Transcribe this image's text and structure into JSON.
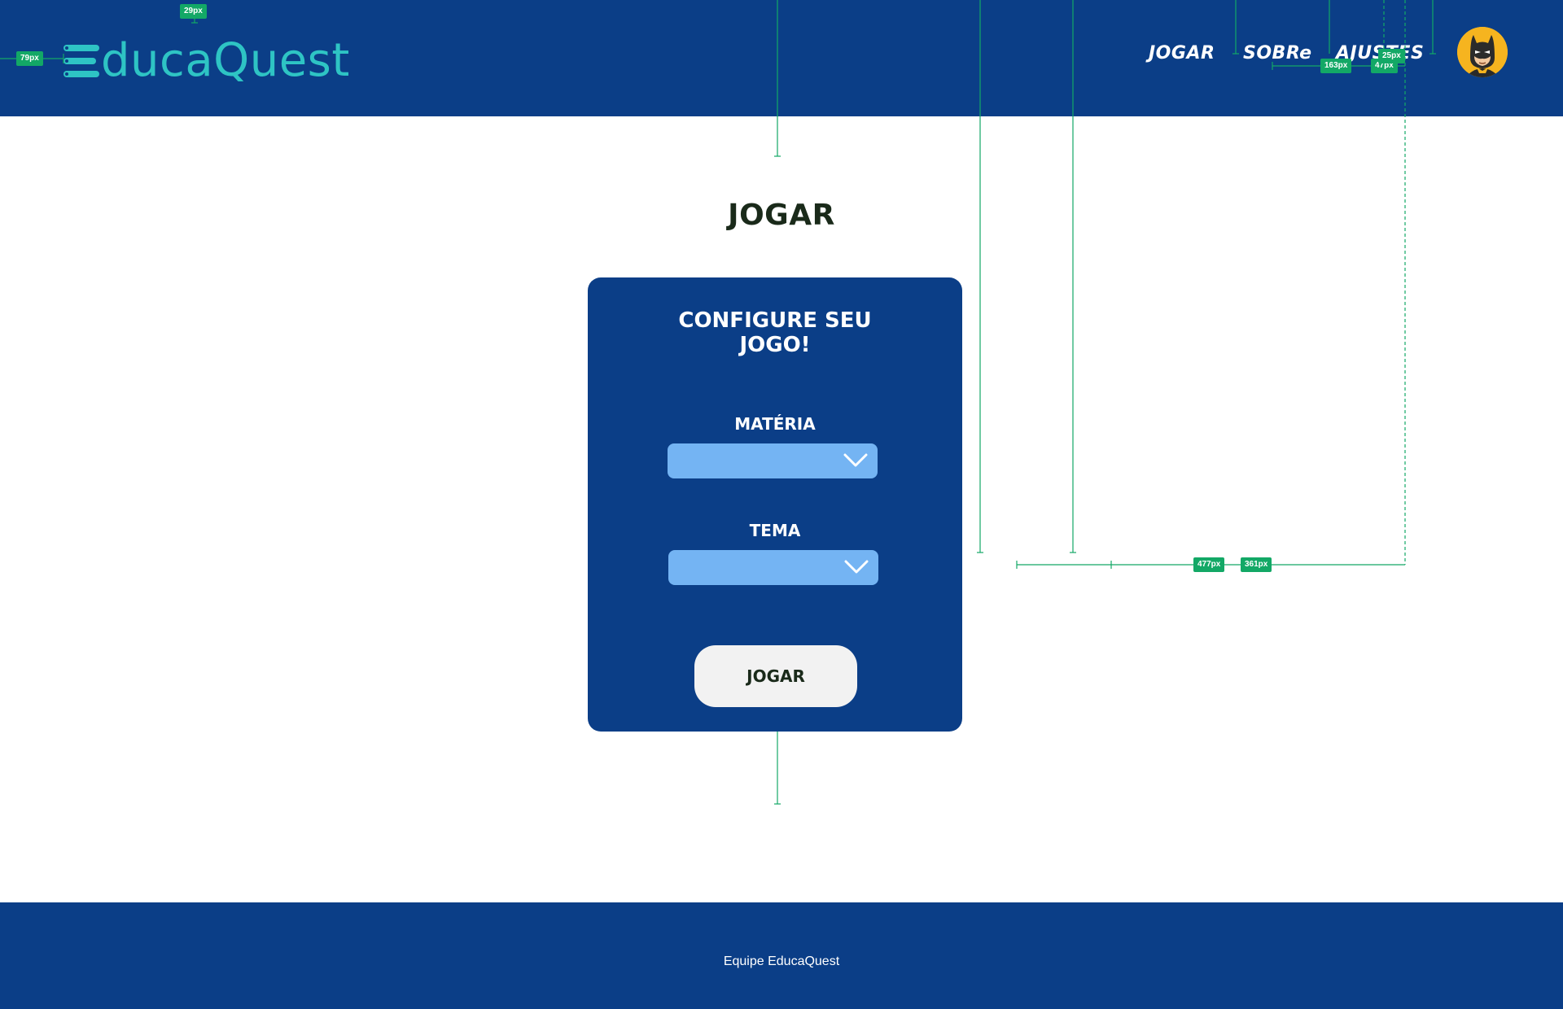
{
  "header": {
    "logo_initial": "E",
    "logo_text": "ducaQuest",
    "nav": {
      "jogar": "JOGAR",
      "sobre": "SOBRe",
      "ajustes": "AJUSTES"
    },
    "avatar_icon": "batman-avatar-icon"
  },
  "main": {
    "title": "JOGAR",
    "card": {
      "title_line1": "CONFIGURE SEU",
      "title_line2": "JOGO!",
      "materia_label": "MATÉRIA",
      "materia_value": "",
      "tema_label": "TEMA",
      "tema_value": "",
      "play_button": "JOGAR"
    }
  },
  "footer": {
    "text": "Equipe EducaQuest"
  },
  "spec_overlay": {
    "measurements": [
      "29px",
      "79px",
      "163px",
      "47px",
      "25px",
      "477px",
      "361px"
    ]
  },
  "colors": {
    "primary_blue": "#0b3e87",
    "logo_teal": "#2ec4c4",
    "select_blue": "#74b4f3",
    "button_bg": "#f2f2f2",
    "spec_green": "#13a866",
    "avatar_yellow": "#f6b41f"
  }
}
